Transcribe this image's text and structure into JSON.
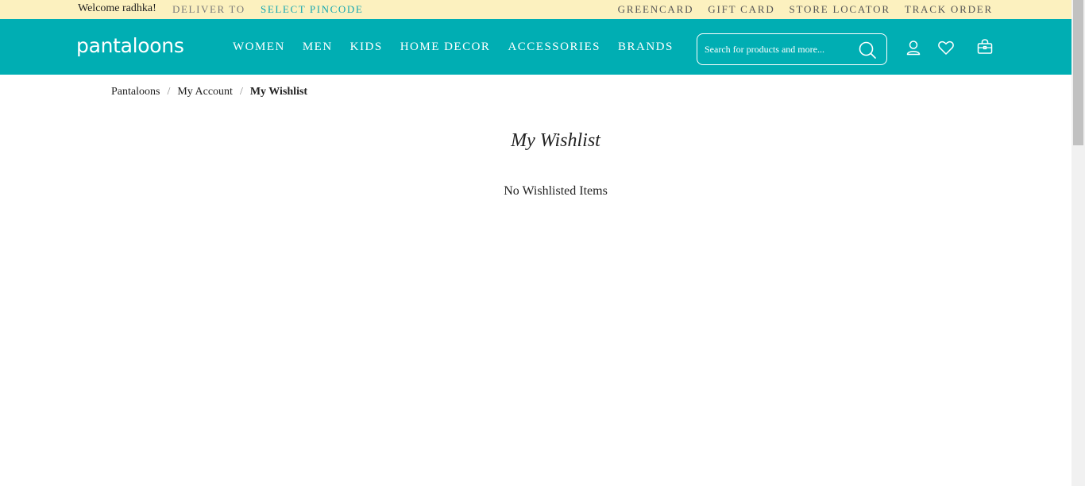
{
  "topbar": {
    "welcome": "Welcome radhka!",
    "deliver_to": "DELIVER TO",
    "select_pincode": "SELECT PINCODE",
    "links": [
      "GREENCARD",
      "GIFT CARD",
      "STORE LOCATOR",
      "TRACK ORDER"
    ]
  },
  "header": {
    "logo": "pantaloons",
    "nav": [
      "WOMEN",
      "MEN",
      "KIDS",
      "HOME DECOR",
      "ACCESSORIES",
      "BRANDS"
    ],
    "search_placeholder": "Search for products and more...",
    "icons": [
      "search-icon",
      "user-icon",
      "heart-icon",
      "bag-icon"
    ]
  },
  "breadcrumb": {
    "items": [
      "Pantaloons",
      "My Account"
    ],
    "separator": "/",
    "current": "My Wishlist"
  },
  "main": {
    "title": "My Wishlist",
    "empty_message": "No Wishlisted Items"
  },
  "colors": {
    "topbar_bg": "#fcf1bf",
    "header_bg": "#00aeb3",
    "accent": "#16a7b1"
  }
}
